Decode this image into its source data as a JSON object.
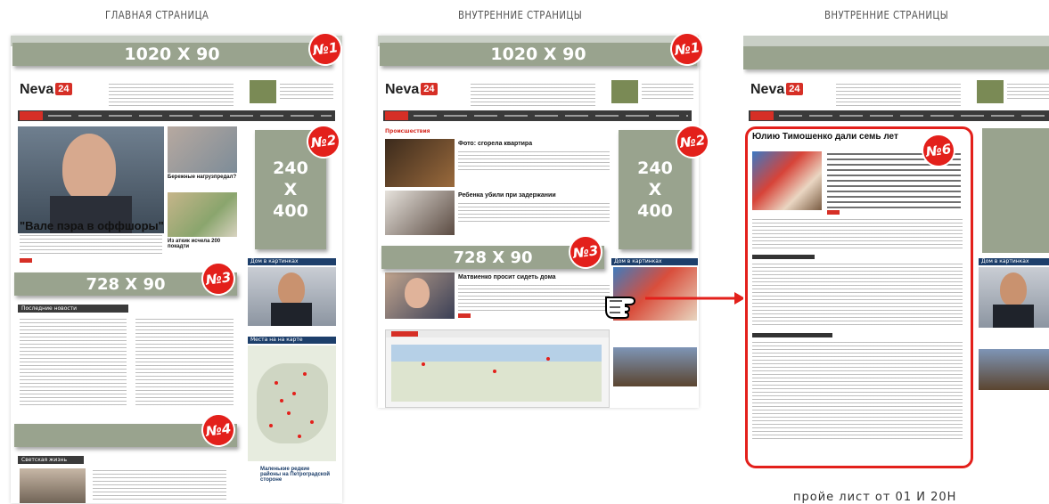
{
  "columns": [
    {
      "title": "ГЛАВНАЯ СТРАНИЦА"
    },
    {
      "title": "ВНУТРЕННИЕ СТРАНИЦЫ"
    },
    {
      "title": "ВНУТРЕННИЕ СТРАНИЦЫ"
    }
  ],
  "banners": {
    "b1_size": "1020 X 90",
    "b2_line1": "240",
    "b2_line2": "X",
    "b2_line3": "400",
    "b3_size": "728 X 90"
  },
  "markers": {
    "n1": "№1",
    "n2": "№2",
    "n3": "№3",
    "n4": "№4",
    "n6": "№6"
  },
  "site": {
    "logo_text": "Neva",
    "logo_tag": "24",
    "main_headline": "\"Вале пэра в оффшоры\"",
    "side_caption_1": "Бережные нагрузпредал?",
    "side_caption_2": "Из аткик исчела 200 покадти",
    "news_header": "Последние новости",
    "light_header": "Светская жизнь",
    "photo_box_header": "Дом в картинках",
    "map_box_header": "Места на на карте",
    "map_caption": "Маленькие редкие районы на Петроградской стороне",
    "inner_section": "Происшествия",
    "inner_item1_title": "Фото: сгорела квартира",
    "inner_item2_title": "Ребенка убили при задержании",
    "inner_item3_title": "Матвиенко просит сидеть дома",
    "article_title": "Юлию Тимошенко дали семь лет"
  },
  "footer_partial": "пройе лист от 01 И 20Н",
  "colors": {
    "banner_gray": "#99a38e",
    "marker_red": "#e3201b",
    "nav_dark": "#3a3a3a",
    "article_frame": "#e3201b"
  },
  "icons": {
    "pointer": "pointing-hand-icon",
    "arrow": "red-arrow-icon"
  }
}
